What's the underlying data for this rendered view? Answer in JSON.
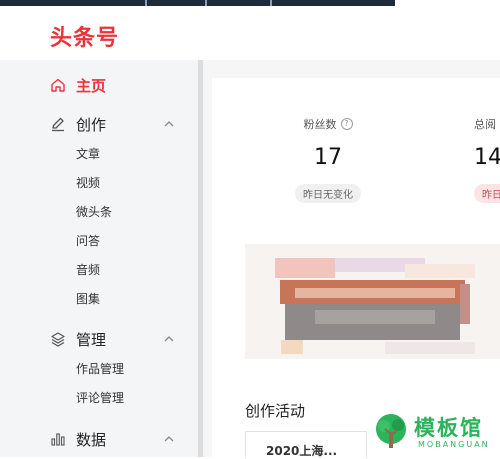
{
  "app": {
    "logo_text": "头条号"
  },
  "sidebar": {
    "home_label": "主页",
    "create": {
      "label": "创作",
      "items": [
        "文章",
        "视频",
        "微头条",
        "问答",
        "音频",
        "图集"
      ]
    },
    "manage": {
      "label": "管理",
      "items": [
        "作品管理",
        "评论管理"
      ]
    },
    "data": {
      "label": "数据"
    }
  },
  "stats": [
    {
      "label": "粉丝数",
      "value": "17",
      "change": "昨日无变化"
    },
    {
      "label": "总阅",
      "value": "14",
      "change": "昨日"
    }
  ],
  "section": {
    "title": "创作活动"
  },
  "activity": {
    "text": "2020上海..."
  },
  "watermark": {
    "cn": "模板馆",
    "en": "MOBANGUAN"
  },
  "colors": {
    "brand_red": "#e8343a",
    "watermark_green": "#2db35c"
  },
  "icons": {
    "home": "home-icon",
    "create": "pen-icon",
    "manage": "layers-icon",
    "data": "bar-chart-icon",
    "expand": "chevron-up-icon",
    "help": "question-circle-icon"
  }
}
